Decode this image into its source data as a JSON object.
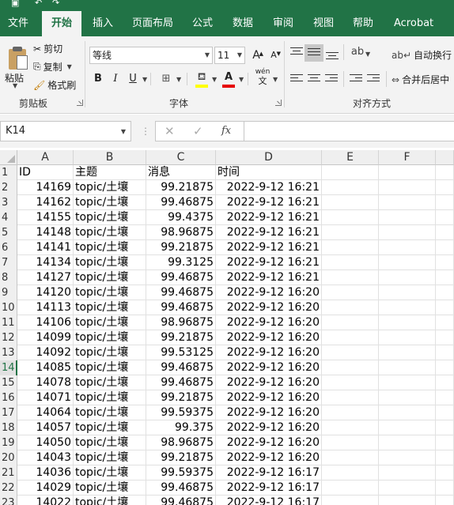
{
  "tabs": [
    "文件",
    "开始",
    "插入",
    "页面布局",
    "公式",
    "数据",
    "审阅",
    "视图",
    "帮助",
    "Acrobat"
  ],
  "clipboard": {
    "paste": "粘贴",
    "cut": "剪切",
    "copy": "复制",
    "format_painter": "格式刷",
    "group_label": "剪贴板"
  },
  "font": {
    "name": "等线",
    "size": "11",
    "grow": "A",
    "shrink": "A",
    "bold": "B",
    "italic": "I",
    "underline": "U",
    "font_color_glyph": "A",
    "phonetic": "wén",
    "group_label": "字体"
  },
  "alignment": {
    "wrap_text": "自动换行",
    "merge_center": "合并后居中",
    "group_label": "对齐方式"
  },
  "formula_bar": {
    "name_box": "K14",
    "cancel": "✕",
    "enter": "✓",
    "fx": "fx",
    "value": ""
  },
  "sheet": {
    "columns": [
      "A",
      "B",
      "C",
      "D",
      "E",
      "F"
    ],
    "selected_row": 14,
    "rows": [
      {
        "n": "1",
        "a": "ID",
        "b": "主题",
        "c": "消息",
        "d": "时间"
      },
      {
        "n": "2",
        "a": "14169",
        "b": "topic/土壤",
        "c": "99.21875",
        "d": "2022-9-12 16:21"
      },
      {
        "n": "3",
        "a": "14162",
        "b": "topic/土壤",
        "c": "99.46875",
        "d": "2022-9-12 16:21"
      },
      {
        "n": "4",
        "a": "14155",
        "b": "topic/土壤",
        "c": "99.4375",
        "d": "2022-9-12 16:21"
      },
      {
        "n": "5",
        "a": "14148",
        "b": "topic/土壤",
        "c": "98.96875",
        "d": "2022-9-12 16:21"
      },
      {
        "n": "6",
        "a": "14141",
        "b": "topic/土壤",
        "c": "99.21875",
        "d": "2022-9-12 16:21"
      },
      {
        "n": "7",
        "a": "14134",
        "b": "topic/土壤",
        "c": "99.3125",
        "d": "2022-9-12 16:21"
      },
      {
        "n": "8",
        "a": "14127",
        "b": "topic/土壤",
        "c": "99.46875",
        "d": "2022-9-12 16:21"
      },
      {
        "n": "9",
        "a": "14120",
        "b": "topic/土壤",
        "c": "99.46875",
        "d": "2022-9-12 16:20"
      },
      {
        "n": "10",
        "a": "14113",
        "b": "topic/土壤",
        "c": "99.46875",
        "d": "2022-9-12 16:20"
      },
      {
        "n": "11",
        "a": "14106",
        "b": "topic/土壤",
        "c": "98.96875",
        "d": "2022-9-12 16:20"
      },
      {
        "n": "12",
        "a": "14099",
        "b": "topic/土壤",
        "c": "99.21875",
        "d": "2022-9-12 16:20"
      },
      {
        "n": "13",
        "a": "14092",
        "b": "topic/土壤",
        "c": "99.53125",
        "d": "2022-9-12 16:20"
      },
      {
        "n": "14",
        "a": "14085",
        "b": "topic/土壤",
        "c": "99.46875",
        "d": "2022-9-12 16:20"
      },
      {
        "n": "15",
        "a": "14078",
        "b": "topic/土壤",
        "c": "99.46875",
        "d": "2022-9-12 16:20"
      },
      {
        "n": "16",
        "a": "14071",
        "b": "topic/土壤",
        "c": "99.21875",
        "d": "2022-9-12 16:20"
      },
      {
        "n": "17",
        "a": "14064",
        "b": "topic/土壤",
        "c": "99.59375",
        "d": "2022-9-12 16:20"
      },
      {
        "n": "18",
        "a": "14057",
        "b": "topic/土壤",
        "c": "99.375",
        "d": "2022-9-12 16:20"
      },
      {
        "n": "19",
        "a": "14050",
        "b": "topic/土壤",
        "c": "98.96875",
        "d": "2022-9-12 16:20"
      },
      {
        "n": "20",
        "a": "14043",
        "b": "topic/土壤",
        "c": "99.21875",
        "d": "2022-9-12 16:20"
      },
      {
        "n": "21",
        "a": "14036",
        "b": "topic/土壤",
        "c": "99.59375",
        "d": "2022-9-12 16:17"
      },
      {
        "n": "22",
        "a": "14029",
        "b": "topic/土壤",
        "c": "99.46875",
        "d": "2022-9-12 16:17"
      },
      {
        "n": "23",
        "a": "14022",
        "b": "topic/土壤",
        "c": "99.46875",
        "d": "2022-9-12 16:17"
      }
    ]
  }
}
